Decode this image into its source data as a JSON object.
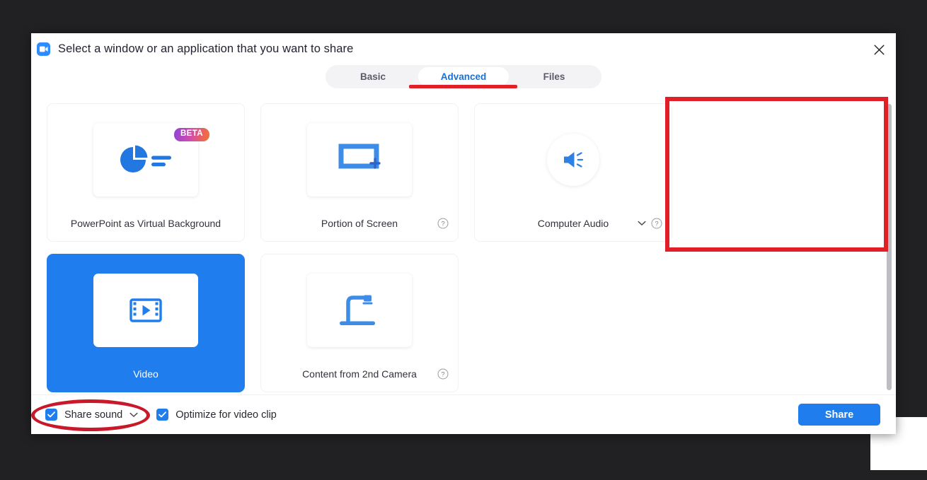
{
  "window": {
    "title": "Select a window or an application that you want to share",
    "logo_icon": "zoom-video-logo-icon",
    "close_icon": "close-icon"
  },
  "tabs": [
    {
      "label": "Basic",
      "active": false
    },
    {
      "label": "Advanced",
      "active": true
    },
    {
      "label": "Files",
      "active": false
    }
  ],
  "cards": [
    {
      "label": "PowerPoint as Virtual Background",
      "icon": "pie-chart-slides-icon",
      "badge": "BETA",
      "selected": false,
      "has_help": false,
      "has_chevron": false
    },
    {
      "label": "Portion of Screen",
      "icon": "screen-region-crosshair-icon",
      "selected": false,
      "has_help": true,
      "has_chevron": false
    },
    {
      "label": "Computer Audio",
      "icon": "speaker-volume-icon",
      "selected": false,
      "has_help": true,
      "has_chevron": true
    },
    {
      "label": "Video",
      "icon": "film-strip-play-icon",
      "selected": true,
      "has_help": false,
      "has_chevron": false
    },
    {
      "label": "Content from 2nd Camera",
      "icon": "document-camera-icon",
      "selected": false,
      "has_help": true,
      "has_chevron": false
    }
  ],
  "footer": {
    "share_sound": {
      "label": "Share sound",
      "checked": true,
      "has_chevron": true
    },
    "optimize_video": {
      "label": "Optimize for video clip",
      "checked": true
    },
    "share_button": "Share"
  },
  "annotations": {
    "tab_underline": "red-underline-advanced-tab",
    "video_box": "red-box-video-card",
    "share_sound_ellipse": "red-ellipse-share-sound"
  },
  "colors": {
    "accent_blue": "#1f7ded",
    "tab_active_text": "#1a6fd4",
    "annotation_red": "#e01f26",
    "backdrop": "#212124"
  }
}
